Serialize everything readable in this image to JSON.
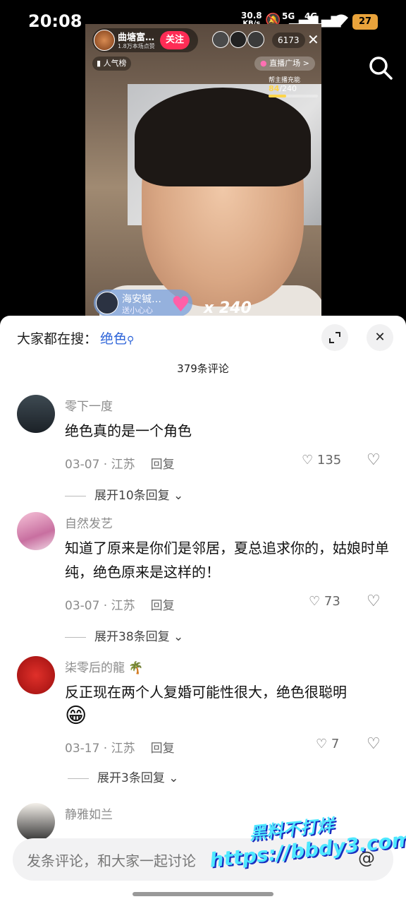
{
  "status_bar": {
    "time": "20:08",
    "net_speed": "30.8",
    "net_unit": "KB/s",
    "signal_5g": "5G",
    "signal_4g": "4G",
    "battery": "27"
  },
  "live": {
    "host_name": "曲塘富…",
    "host_fans": "1.8万本场点赞",
    "follow_label": "关注",
    "viewer_count": "6173",
    "rank_label": "人气榜",
    "plaza_label": "直播广场 >",
    "charge_label": "帮主播充能",
    "charge_current": "84",
    "charge_total": "/240",
    "charge_progress": 0.35,
    "gift_user": "海安铖…",
    "gift_sub": "送小心心",
    "gift_count": "x 240"
  },
  "comments_sheet": {
    "hot_search_label": "大家都在搜：",
    "hot_search_keyword": "绝色",
    "comment_count": "379条评论",
    "comments": [
      {
        "user": "零下一度",
        "text": "绝色真的是一个角色",
        "date": "03-07 · 江苏",
        "reply": "回复",
        "likes": "135",
        "expand": "展开10条回复"
      },
      {
        "user": "自然发艺",
        "text": "知道了原来是你们是邻居，夏总追求你的，姑娘时单纯，绝色原来是这样的！",
        "date": "03-07 · 江苏",
        "reply": "回复",
        "likes": "73",
        "expand": "展开38条回复"
      },
      {
        "user": "柒零后的龍",
        "text": "反正现在两个人复婚可能性很大，绝色很聪明",
        "emoji": "😁",
        "date": "03-17 · 江苏",
        "reply": "回复",
        "likes": "7",
        "expand": "展开3条回复"
      },
      {
        "user": "静雅如兰"
      }
    ],
    "input_placeholder": "发条评论，和大家一起讨论",
    "watermark_line1": "黑料不打烊",
    "watermark_line2": "https://bbdy3.com"
  }
}
